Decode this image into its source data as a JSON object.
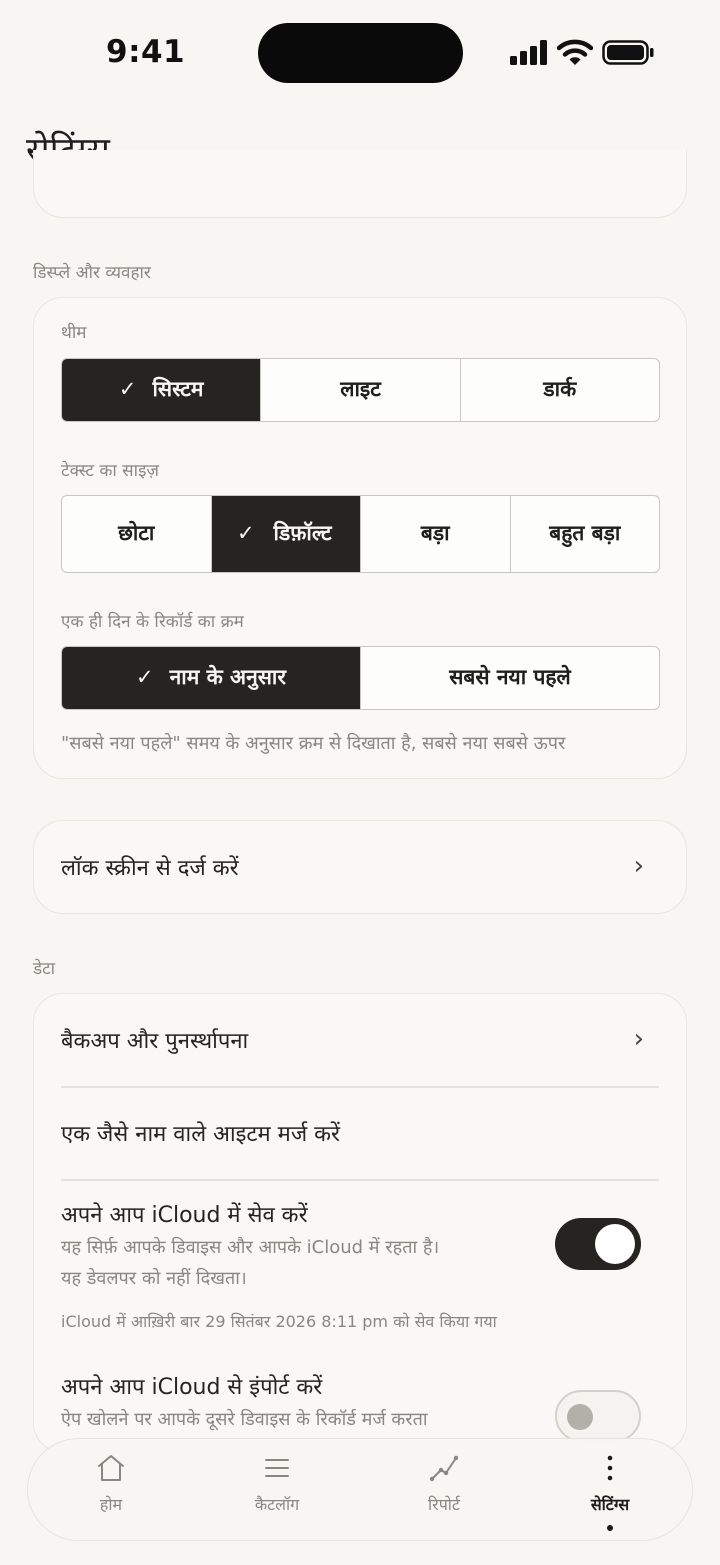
{
  "status_bar": {
    "time": "9:41"
  },
  "page": {
    "title": "सेटिंग्स"
  },
  "display_section": {
    "label": "डिस्प्ले और व्यवहार",
    "theme": {
      "label": "थीम",
      "options": [
        "सिस्टम",
        "लाइट",
        "डार्क"
      ],
      "selected": "सिस्टम"
    },
    "text_size": {
      "label": "टेक्स्ट का साइज़",
      "options": [
        "छोटा",
        "डिफ़ॉल्ट",
        "बड़ा",
        "बहुत बड़ा"
      ],
      "selected": "डिफ़ॉल्ट"
    },
    "record_order": {
      "label": "एक ही दिन के रिकॉर्ड का क्रम",
      "options": [
        "नाम के अनुसार",
        "सबसे नया पहले"
      ],
      "selected": "नाम के अनुसार",
      "hint": "\"सबसे नया पहले\" समय के अनुसार क्रम से दिखाता है, सबसे नया सबसे ऊपर"
    }
  },
  "lock_screen_row": {
    "label": "लॉक स्क्रीन से दर्ज करें"
  },
  "data_section": {
    "label": "डेटा",
    "backup": {
      "label": "बैकअप और पुनर्स्थापना"
    },
    "merge": {
      "label": "एक जैसे नाम वाले आइटम मर्ज करें"
    },
    "auto_save": {
      "title": "अपने आप iCloud में सेव करें",
      "description_line1": "यह सिर्फ़ आपके डिवाइस और आपके iCloud में रहता है।",
      "description_line2": "यह डेवलपर को नहीं दिखता।",
      "last_saved": "iCloud में आख़िरी बार 29 सितंबर 2026 8:11 pm को सेव किया गया",
      "enabled": true
    },
    "auto_import": {
      "title": "अपने आप iCloud से इंपोर्ट करें",
      "description": "ऐप खोलने पर आपके दूसरे डिवाइस के रिकॉर्ड मर्ज करता",
      "enabled": false
    }
  },
  "tab_bar": {
    "tabs": [
      {
        "label": "होम",
        "icon": "home-icon"
      },
      {
        "label": "कैटलॉग",
        "icon": "list-icon"
      },
      {
        "label": "रिपोर्ट",
        "icon": "chart-icon"
      },
      {
        "label": "सेटिंग्स",
        "icon": "more-vertical-icon"
      }
    ],
    "active": "सेटिंग्स"
  }
}
